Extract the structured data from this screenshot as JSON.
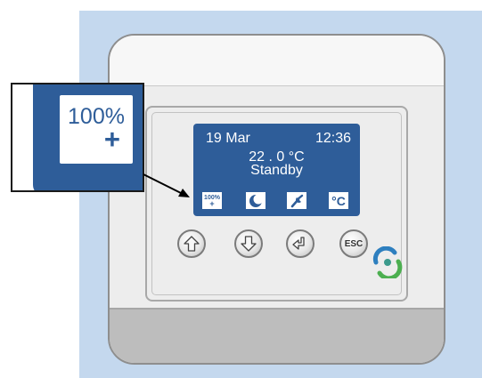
{
  "display": {
    "date": "19 Mar",
    "time": "12:36",
    "temperature": "22 . 0 °C",
    "mode": "Standby"
  },
  "status_icons": {
    "boost_percent": "100%",
    "boost_plus": "+",
    "celsius": "°C"
  },
  "buttons": {
    "esc_label": "ESC"
  },
  "zoom": {
    "percent": "100%",
    "plus": "+"
  },
  "icons": [
    "boost-icon",
    "moon-icon",
    "wrench-icon",
    "celsius-icon",
    "up-arrow-icon",
    "down-arrow-icon",
    "enter-icon",
    "brand-logo-icon"
  ],
  "colors": {
    "lcd_background": "#2e5d99",
    "page_background": "#c4d8ee",
    "device_body": "#ededed"
  }
}
